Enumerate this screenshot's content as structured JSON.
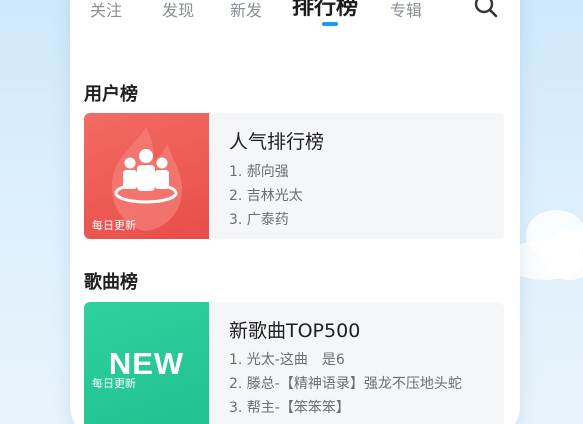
{
  "tabs": [
    {
      "label": "关注"
    },
    {
      "label": "发现"
    },
    {
      "label": "新发"
    },
    {
      "label": "排行榜"
    },
    {
      "label": "专辑"
    }
  ],
  "active_tab": "排行榜",
  "icons": {
    "search": "search-icon",
    "users": "group-users-icon"
  },
  "colors": {
    "accent": "#1b9af2",
    "red_cover": "#e84d49",
    "green_cover": "#20bf8f"
  },
  "sections": [
    {
      "title": "用户榜",
      "card": {
        "cover_tag": "每日更新",
        "title": "人气排行榜",
        "lines": [
          "1. 郝向强",
          "2. 吉林光太",
          "3. 广泰药"
        ]
      }
    },
    {
      "title": "歌曲榜",
      "card": {
        "cover_text": "NEW",
        "cover_tag": "每日更新",
        "title": "新歌曲TOP500",
        "lines": [
          "1. 光太-这曲　是6",
          "2. 滕总-【精神语录】强龙不压地头蛇",
          "3. 帮主-【笨笨笨】"
        ]
      }
    }
  ]
}
